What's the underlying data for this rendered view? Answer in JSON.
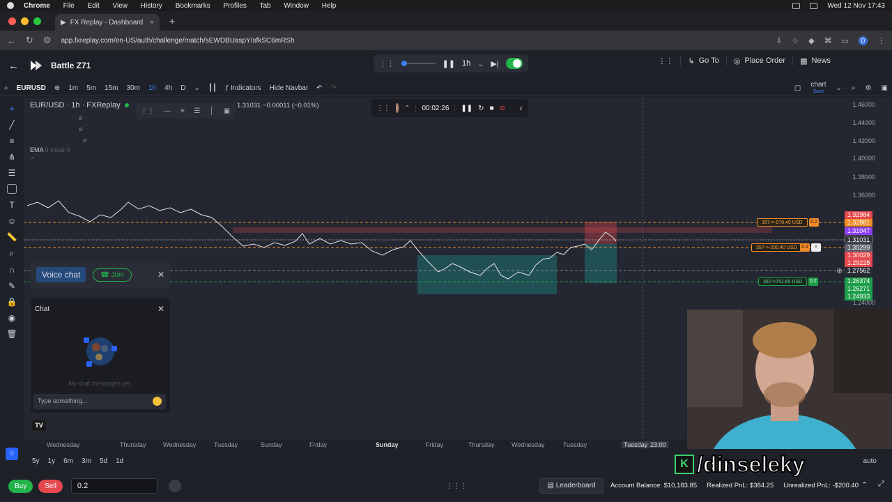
{
  "mac_menu": {
    "app": "Chrome",
    "items": [
      "File",
      "Edit",
      "View",
      "History",
      "Bookmarks",
      "Profiles",
      "Tab",
      "Window",
      "Help"
    ],
    "clock": "Wed 12 Nov 17:43"
  },
  "browser": {
    "tab_title": "FX Replay - Dashboard",
    "url": "app.fxreplay.com/en-US/auth/challenge/match/sEWDBUaspY/sfkSC6mRSh",
    "avatar": "D"
  },
  "app": {
    "title": "Battle Z71",
    "replay_timeframe": "1h",
    "go_to": "Go To",
    "place_order": "Place Order",
    "news": "News"
  },
  "toolbar": {
    "symbol": "EURUSD",
    "timeframes": [
      "1m",
      "5m",
      "15m",
      "30m",
      "1h",
      "4h",
      "D"
    ],
    "active_tf": "1h",
    "indicators": "Indicators",
    "hide_navbar": "Hide Navbar",
    "layout_name": "chart",
    "layout_sub": "Save"
  },
  "chart": {
    "legend": "EUR/USD · 1h · FXReplay",
    "ohlc": "1.31031  −0.00011 (−0.01%)",
    "ema": "EMA",
    "ema_params": "9 close 0",
    "timer": "00:02:26",
    "price_ticks": [
      "1.46000",
      "1.44000",
      "1.42000",
      "1.40000",
      "1.38000",
      "1.36000",
      "1.24000"
    ],
    "price_boxes": [
      {
        "v": "1.32984",
        "c": "#e5484d"
      },
      {
        "v": "1.32881",
        "c": "#f28c28"
      },
      {
        "v": "1.31047",
        "c": "#8a3ff0"
      },
      {
        "v": "1.31031",
        "c": "#2a2d36"
      },
      {
        "v": "1.30299",
        "c": "#5c5f6b"
      },
      {
        "v": "1.30029",
        "c": "#e5484d"
      },
      {
        "v": "1.29228",
        "c": "#e5484d"
      },
      {
        "v": "1.27562",
        "c": "#2a2d36"
      },
      {
        "v": "1.26374",
        "c": "#1e9e4a"
      },
      {
        "v": "1.26271",
        "c": "#1e9e4a"
      },
      {
        "v": "1.24933",
        "c": "#1e9e4a"
      }
    ],
    "positions": [
      {
        "label": "357->-570.40 USD",
        "qty": "0.2"
      },
      {
        "label": "357->-200.40 USD",
        "qty": "0.2"
      },
      {
        "label": "357->751.60 USD",
        "qty": "0.2"
      }
    ],
    "time_labels": [
      "Wednesday",
      "Thursday",
      "Wednesday",
      "Tuesday",
      "Sunday",
      "Friday",
      "Sunday",
      "Friday",
      "Thursday",
      "Wednesday",
      "Tuesday",
      "Tuesday",
      "23:00"
    ],
    "ranges": [
      "5y",
      "1y",
      "6m",
      "3m",
      "5d",
      "1d"
    ],
    "scale_mode": "auto"
  },
  "voice_chat": {
    "label": "Voice chat",
    "join": "Join"
  },
  "chat": {
    "title": "Chat",
    "empty": "No chat messages yet.",
    "placeholder": "Type something..."
  },
  "watermark": {
    "handle": "/dinseleky",
    "k": "K"
  },
  "bottom": {
    "buy": "Buy",
    "sell": "Sell",
    "qty": "0.2",
    "leaderboard": "Leaderboard",
    "balance": "Account Balance: $10,183.85",
    "realized": "Realized PnL: $384.25",
    "unrealized": "Unrealized PnL: -$200.40"
  }
}
